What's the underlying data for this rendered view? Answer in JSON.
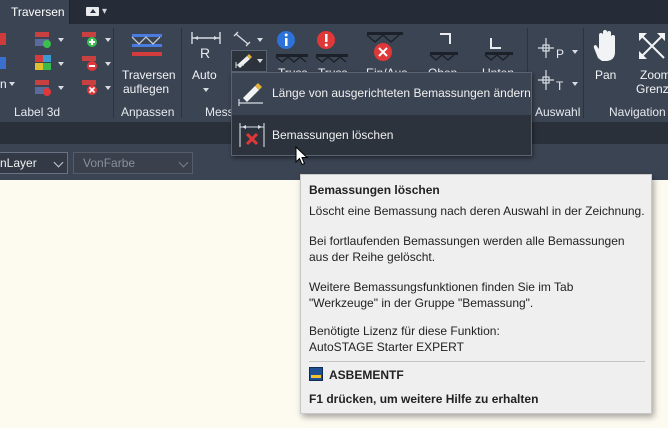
{
  "tabs": {
    "active": "Traversen"
  },
  "ribbon": {
    "panels": {
      "label3d": "Label 3d",
      "anpassen": "Anpassen",
      "messen": "Mess",
      "auswahl": "Auswahl",
      "navigation": "Navigation"
    },
    "buttons": {
      "label3d_partial": "n",
      "traversen_auflegen_line1": "Traversen",
      "traversen_auflegen_line2": "auflegen",
      "auto": "Auto",
      "truss1": "Truss",
      "truss2": "Truss",
      "einaus": "Ein/Aus",
      "oben": "Oben",
      "unten": "Unten",
      "pan": "Pan",
      "zoom_line1": "Zoom",
      "zoom_line2": "Grenz"
    }
  },
  "properties": {
    "layer_value": "nLayer",
    "color_value": "VonFarbe"
  },
  "flyout": {
    "items": [
      {
        "label": "Länge von ausgerichteten Bemassungen ändern"
      },
      {
        "label": "Bemassungen löschen"
      }
    ]
  },
  "tooltip": {
    "title": "Bemassungen löschen",
    "paragraphs": [
      "Löscht eine Bemassung nach deren Auswahl in der Zeichnung.",
      "Bei fortlaufenden Bemassungen werden alle Bemassungen aus der Reihe gelöscht.",
      "Weitere Bemassungsfunktionen finden Sie im Tab \"Werkzeuge\" in der Gruppe \"Bemassung\".",
      "Benötigte Lizenz für diese Funktion: AutoSTAGE Starter EXPERT"
    ],
    "command": "ASBEMENTF",
    "f1_hint": "F1 drücken, um weitere Hilfe zu erhalten"
  },
  "colors": {
    "ribbon_bg": "#3b4453",
    "tab_strip_bg": "#252c37",
    "canvas_bg": "#fdfaf0",
    "tooltip_bg": "#efefef",
    "delete_red": "#e03838"
  }
}
